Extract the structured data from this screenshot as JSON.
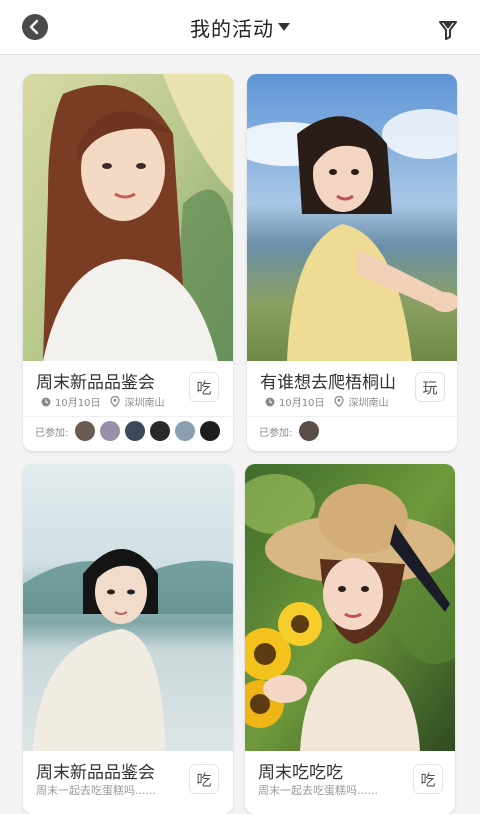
{
  "header": {
    "title": "我的活动",
    "back_icon": "back-arrow-icon",
    "dropdown_icon": "caret-down-icon",
    "filter_icon": "filter-icon"
  },
  "cards": [
    {
      "title": "周末新品品鉴会",
      "date": "10月10日",
      "location": "深圳南山",
      "category": "吃",
      "joined_label": "已参加:",
      "avatars": [
        "#6b5a52",
        "#9a8fa8",
        "#3b4a56",
        "#2a2a2a",
        "#8aa0b0",
        "#1d1d1d"
      ]
    },
    {
      "title": "有谁想去爬梧桐山",
      "date": "10月10日",
      "location": "深圳南山",
      "category": "玩",
      "joined_label": "已参加:",
      "avatars": [
        "#5a4e46"
      ]
    },
    {
      "title": "周末新品品鉴会",
      "description": "周末一起去吃蛋糕吗......",
      "category": "吃"
    },
    {
      "title": "周末吃吃吃",
      "description": "周末一起去吃蛋糕吗......",
      "category": "吃"
    }
  ]
}
